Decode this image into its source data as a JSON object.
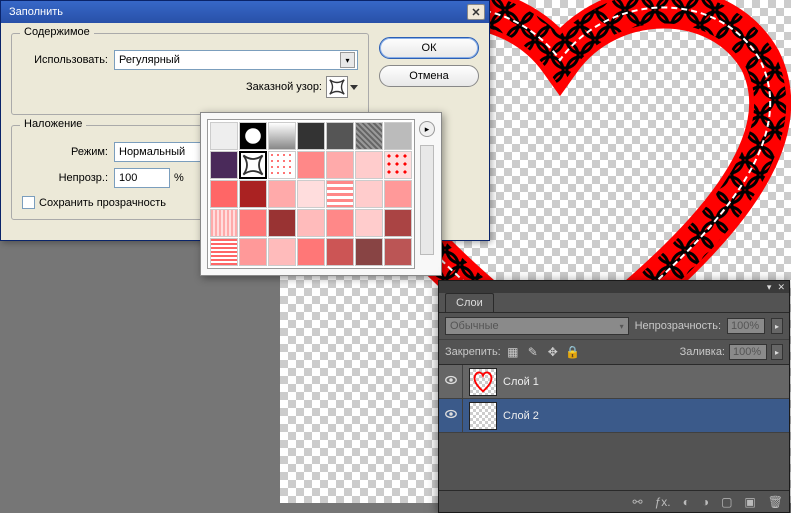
{
  "dialog": {
    "title": "Заполнить",
    "content_legend": "Содержимое",
    "use_label": "Использовать:",
    "use_value": "Регулярный",
    "custom_pattern_label": "Заказной узор:",
    "blending_legend": "Наложение",
    "mode_label": "Режим:",
    "mode_value": "Нормальный",
    "opacity_label": "Непрозр.:",
    "opacity_value": "100",
    "opacity_unit": "%",
    "preserve_transparency": "Сохранить прозрачность",
    "ok": "ОК",
    "cancel": "Отмена"
  },
  "layers": {
    "tab": "Слои",
    "blend_mode": "Обычные",
    "opacity_label": "Непрозрачность:",
    "opacity_value": "100%",
    "lock_label": "Закрепить:",
    "fill_label": "Заливка:",
    "fill_value": "100%",
    "items": [
      {
        "name": "Слой 1"
      },
      {
        "name": "Слой 2"
      }
    ]
  },
  "patterns": {
    "rows": 5,
    "cols": 7,
    "selected_index": 8
  }
}
